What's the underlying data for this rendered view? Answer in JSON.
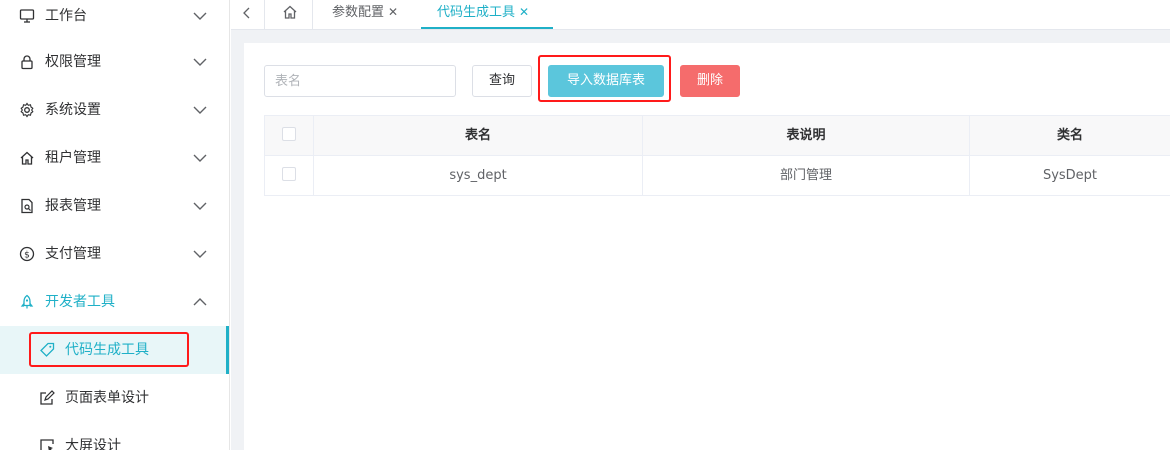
{
  "sidebar": {
    "items": [
      {
        "label": "工作台",
        "icon": "monitor-icon"
      },
      {
        "label": "权限管理",
        "icon": "lock-icon"
      },
      {
        "label": "系统设置",
        "icon": "gear-icon"
      },
      {
        "label": "租户管理",
        "icon": "home-icon"
      },
      {
        "label": "报表管理",
        "icon": "report-icon"
      },
      {
        "label": "支付管理",
        "icon": "dollar-icon"
      },
      {
        "label": "开发者工具",
        "icon": "rocket-icon"
      }
    ],
    "subitems": [
      {
        "label": "代码生成工具",
        "icon": "tag-icon"
      },
      {
        "label": "页面表单设计",
        "icon": "edit-icon"
      },
      {
        "label": "大屏设计",
        "icon": "screen-icon"
      }
    ]
  },
  "tabs": [
    {
      "label": "参数配置"
    },
    {
      "label": "代码生成工具"
    }
  ],
  "toolbar": {
    "search_placeholder": "表名",
    "query_label": "查询",
    "import_label": "导入数据库表",
    "delete_label": "删除"
  },
  "table": {
    "headers": [
      "表名",
      "表说明",
      "类名"
    ],
    "rows": [
      [
        "sys_dept",
        "部门管理",
        "SysDept"
      ]
    ]
  },
  "colors": {
    "accent": "#1fb0c7",
    "import_button": "#5bc6dc",
    "delete_button": "#f56c6c",
    "highlight": "#ff1a1a"
  }
}
